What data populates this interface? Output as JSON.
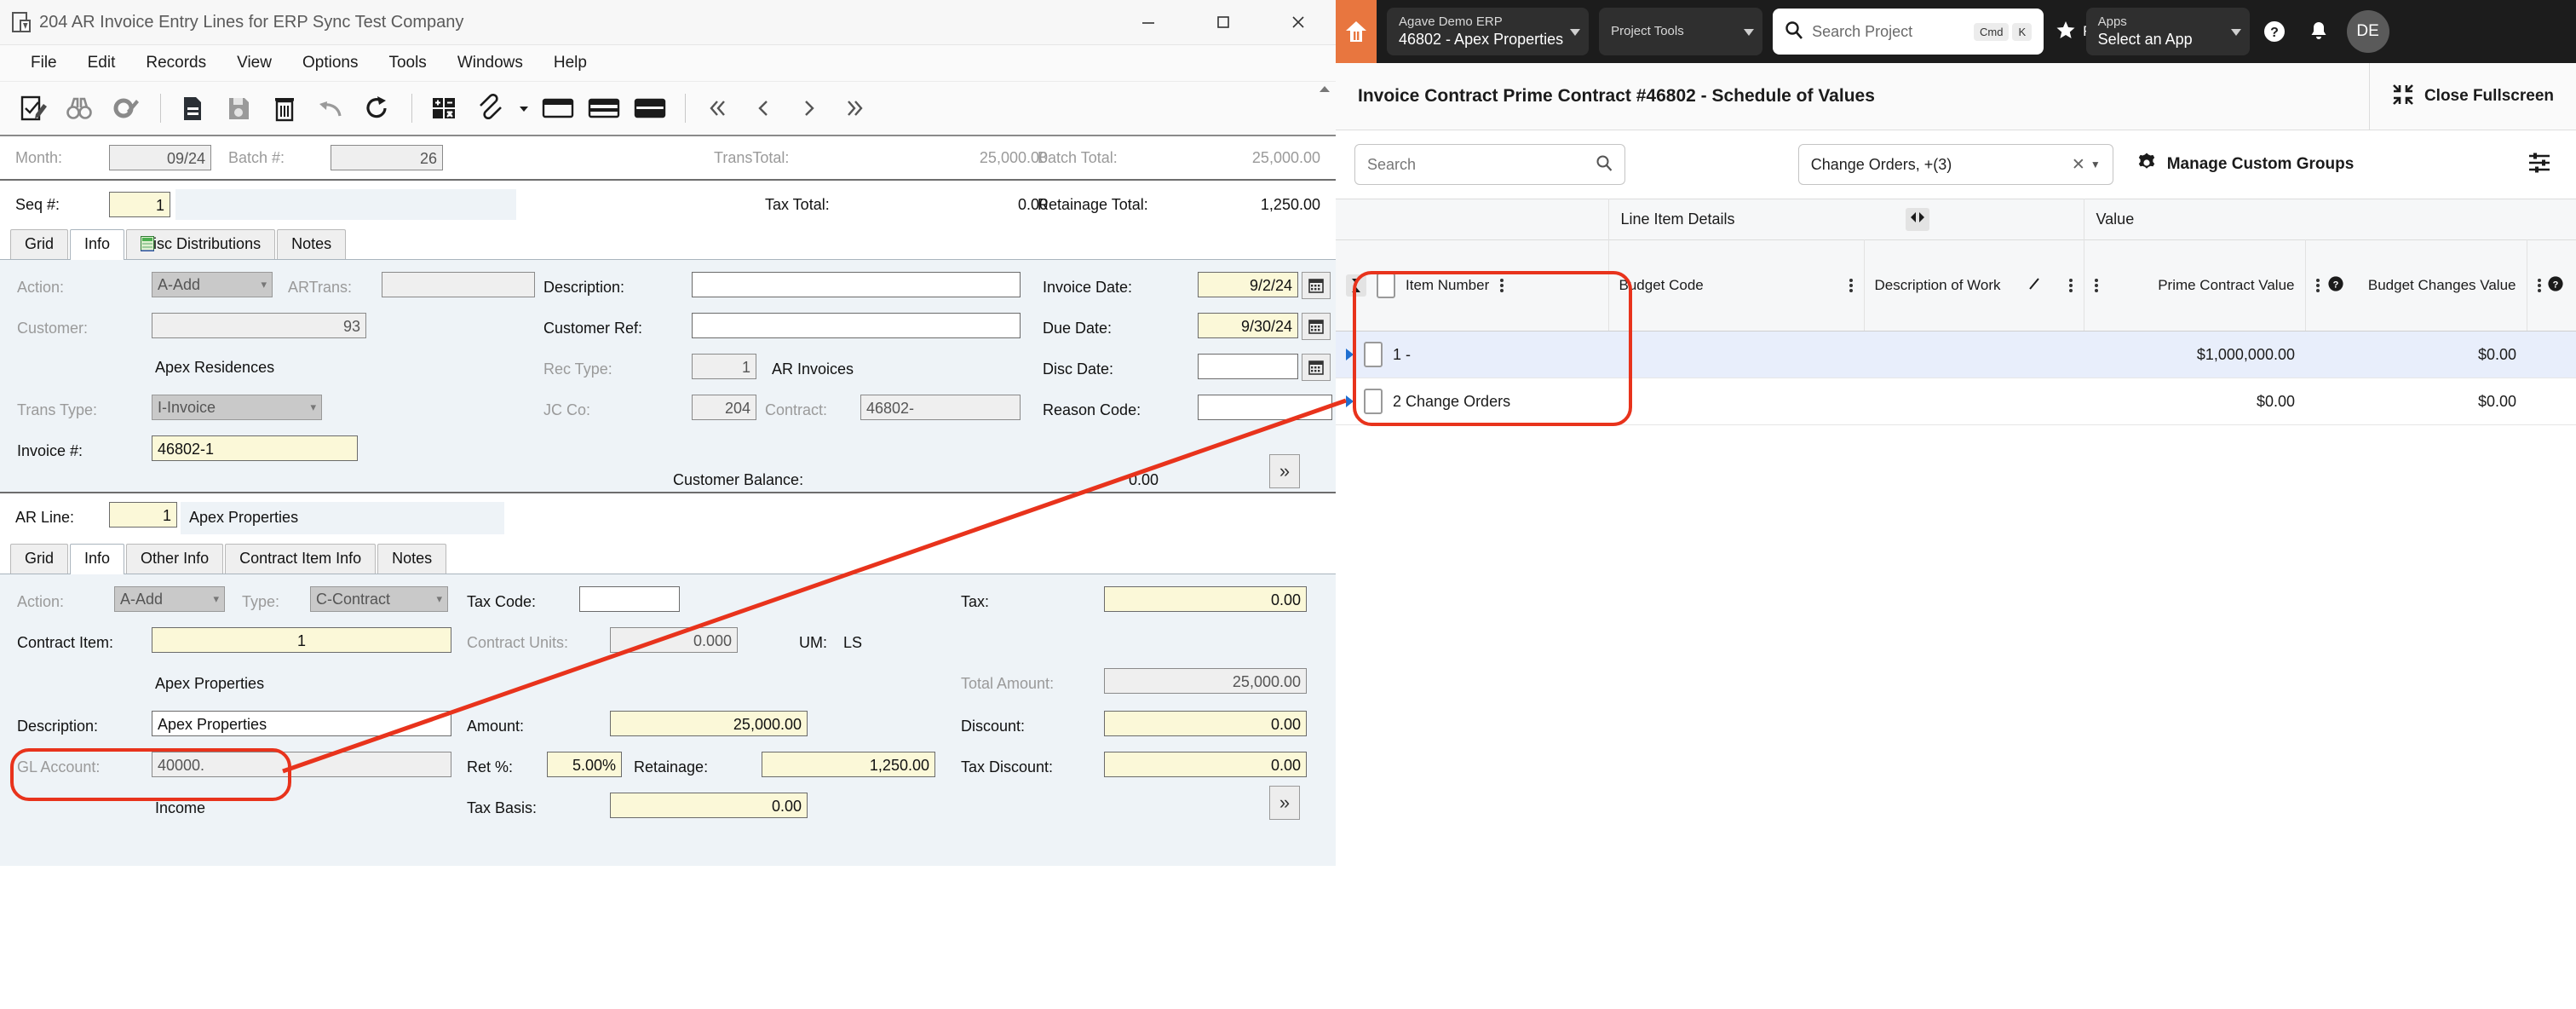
{
  "erp": {
    "window_title": "204 AR Invoice Entry Lines for ERP Sync Test Company",
    "window_buttons": {
      "minimize": "–",
      "maximize": "☐",
      "close": "✕"
    },
    "menu": [
      "File",
      "Edit",
      "Records",
      "View",
      "Options",
      "Tools",
      "Windows",
      "Help"
    ],
    "toolbar_icons": [
      "edit-check-icon",
      "binoculars-find-icon",
      "find-settings-icon",
      "new-document-icon",
      "save-icon",
      "delete-icon",
      "undo-icon",
      "refresh-icon",
      "calculator-icon",
      "attachment-icon",
      "attachment-dropdown-icon",
      "layout-single-icon",
      "layout-split-icon",
      "layout-stacked-icon",
      "first-record-icon",
      "prev-record-icon",
      "next-record-icon",
      "last-record-icon"
    ],
    "batch": {
      "month_label": "Month:",
      "month_value": "09/24",
      "batch_label": "Batch #:",
      "batch_value": "26",
      "transtotal_label": "TransTotal:",
      "transtotal_value": "25,000.00",
      "batchtotal_label": "Batch Total:",
      "batchtotal_value": "25,000.00"
    },
    "seq": {
      "seq_label": "Seq #:",
      "seq_value": "1",
      "taxtotal_label": "Tax Total:",
      "taxtotal_value": "0.00",
      "retainagetotal_label": "Retainage Total:",
      "retainagetotal_value": "1,250.00"
    },
    "header_tabs": [
      {
        "label": "Grid",
        "active": false
      },
      {
        "label": "Info",
        "active": true
      },
      {
        "label": "Misc Distributions",
        "active": false,
        "icon": "spreadsheet-icon"
      },
      {
        "label": "Notes",
        "active": false
      }
    ],
    "header_form": {
      "action_label": "Action:",
      "action_value": "A-Add",
      "artrans_label": "ARTrans:",
      "artrans_value": "",
      "customer_label": "Customer:",
      "customer_value": "93",
      "customer_name": "Apex Residences",
      "transtype_label": "Trans Type:",
      "transtype_value": "I-Invoice",
      "invoice_label": "Invoice #:",
      "invoice_value": "46802-1",
      "description_label": "Description:",
      "description_value": "",
      "customerref_label": "Customer Ref:",
      "customerref_value": "",
      "rectype_label": "Rec Type:",
      "rectype_value": "1",
      "rectype_desc": "AR Invoices",
      "jcco_label": "JC Co:",
      "jcco_value": "204",
      "contract_label": "Contract:",
      "contract_value": "46802-",
      "invoicedate_label": "Invoice Date:",
      "invoicedate_value": "9/2/24",
      "duedate_label": "Due Date:",
      "duedate_value": "9/30/24",
      "discdate_label": "Disc Date:",
      "discdate_value": "",
      "reasoncode_label": "Reason Code:",
      "reasoncode_value": "",
      "customerbalance_label": "Customer Balance:",
      "customerbalance_value": "0.00",
      "expand_button": "»"
    },
    "line": {
      "arline_label": "AR Line:",
      "arline_value": "1",
      "arline_desc": "Apex Properties",
      "tabs": [
        {
          "label": "Grid",
          "active": false
        },
        {
          "label": "Info",
          "active": true
        },
        {
          "label": "Other Info",
          "active": false
        },
        {
          "label": "Contract Item Info",
          "active": false
        },
        {
          "label": "Notes",
          "active": false
        }
      ],
      "action_label": "Action:",
      "action_value": "A-Add",
      "type_label": "Type:",
      "type_value": "C-Contract",
      "taxcode_label": "Tax Code:",
      "taxcode_value": "",
      "tax_label": "Tax:",
      "tax_value": "0.00",
      "contractitem_label": "Contract Item:",
      "contractitem_value": "1",
      "contractitem_desc": "Apex Properties",
      "contractunits_label": "Contract Units:",
      "contractunits_value": "0.000",
      "um_label": "UM:",
      "um_value": "LS",
      "totalamount_label": "Total Amount:",
      "totalamount_value": "25,000.00",
      "description_label": "Description:",
      "description_value": "Apex Properties",
      "amount_label": "Amount:",
      "amount_value": "25,000.00",
      "discount_label": "Discount:",
      "discount_value": "0.00",
      "glaccount_label": "GL Account:",
      "glaccount_value": "40000.",
      "glaccount_desc": "Income",
      "retpct_label": "Ret %:",
      "retpct_value": "5.00%",
      "retainage_label": "Retainage:",
      "retainage_value": "1,250.00",
      "taxdiscount_label": "Tax Discount:",
      "taxdiscount_value": "0.00",
      "taxbasis_label": "Tax Basis:",
      "taxbasis_value": "0.00",
      "expand_button": "»"
    }
  },
  "web": {
    "topbar": {
      "home_icon": "home-icon",
      "company_pill": {
        "line1": "Agave Demo ERP",
        "line2": "46802 - Apex Properties"
      },
      "project_tools_pill": {
        "line1": "Project Tools",
        "line2": ""
      },
      "search": {
        "placeholder": "Search Project",
        "key1": "Cmd",
        "key2": "K"
      },
      "favorites_label": "Favor",
      "apps_pill": {
        "line1": "Apps",
        "line2": "Select an App"
      },
      "help_icon": "help-circle-icon",
      "bell_icon": "notification-bell-icon",
      "avatar_initials": "DE"
    },
    "page_title": "Invoice Contract Prime Contract #46802 - Schedule of Values",
    "close_fullscreen": {
      "label": "Close Fullscreen",
      "icon": "collapse-fullscreen-icon"
    },
    "toolbar": {
      "search_placeholder": "Search",
      "search_icon": "search-icon",
      "filter_value": "Change Orders, +(3)",
      "filter_clear_icon": "clear-x-icon",
      "filter_caret_icon": "chevron-down-icon",
      "manage_custom_groups": "Manage Custom Groups",
      "gear_icon": "gear-icon",
      "settings_icon": "column-settings-icon"
    },
    "table": {
      "group_headers": [
        {
          "label": "Item Number",
          "kind": "frozen"
        },
        {
          "label": "Line Item Details",
          "resize_icon": "horizontal-resize-icon"
        },
        {
          "label": "Value"
        }
      ],
      "columns": [
        {
          "label": "Item Number",
          "align": "left"
        },
        {
          "label": "Budget Code",
          "align": "left"
        },
        {
          "label": "Description of Work",
          "align": "left",
          "edit_icon": "pencil-icon"
        },
        {
          "label": "Prime Contract Value",
          "align": "right"
        },
        {
          "label": "Budget Changes Value",
          "align": "right",
          "help_icon": "help-circle-icon"
        }
      ],
      "rows": [
        {
          "item_number": "1 -",
          "budget_code": "",
          "description_of_work": "",
          "prime_contract_value": "$1,000,000.00",
          "budget_changes_value": "$0.00",
          "selected": true
        },
        {
          "item_number": "2 Change Orders",
          "budget_code": "",
          "description_of_work": "",
          "prime_contract_value": "$0.00",
          "budget_changes_value": "$0.00",
          "selected": false
        }
      ]
    }
  },
  "annotation": {
    "color": "#e8331c",
    "highlights": [
      "contract-item-field",
      "item-number-column"
    ]
  }
}
